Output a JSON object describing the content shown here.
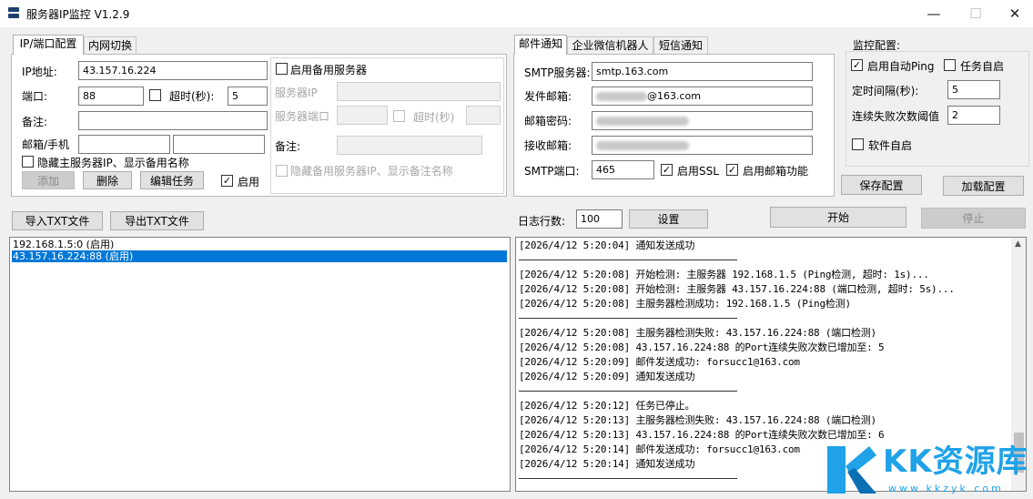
{
  "window": {
    "title": "服务器IP监控 V1.2.9",
    "min_symbol": "—",
    "max_symbol": "☐",
    "close_symbol": "✕"
  },
  "left_tabs": [
    "IP/端口配置",
    "内网切换"
  ],
  "main_server": {
    "ip_label": "IP地址:",
    "ip_value": "43.157.16.224",
    "port_label": "端口:",
    "port_value": "88",
    "timeout_label": "超时(秒):",
    "timeout_value": "5",
    "timeout_checked": false,
    "note_label": "备注:",
    "note_value": "",
    "contact_label": "邮箱/手机",
    "contact_value1": "",
    "contact_value2": "",
    "hide_label": "隐藏主服务器IP、显示备用名称",
    "hide_checked": false,
    "add_label": "添加",
    "delete_label": "删除",
    "edit_label": "编辑任务",
    "enable_label": "启用",
    "enable_checked": true
  },
  "backup_server": {
    "enable_label": "启用备用服务器",
    "enable_checked": false,
    "ip_label": "服务器IP",
    "port_label": "服务器端口",
    "timeout_label": "超时(秒)",
    "note_label": "备注:",
    "hide_label": "隐藏备用服务器IP、显示备注名称"
  },
  "notify_tabs": [
    "邮件通知",
    "企业微信机器人",
    "短信通知"
  ],
  "email": {
    "smtp_server_label": "SMTP服务器:",
    "smtp_server_value": "smtp.163.com",
    "sender_label": "发件邮箱:",
    "sender_value_visible": "@163.com",
    "password_label": "邮箱密码:",
    "receiver_label": "接收邮箱:",
    "smtp_port_label": "SMTP端口:",
    "smtp_port_value": "465",
    "ssl_label": "启用SSL",
    "ssl_checked": true,
    "email_enable_label": "启用邮箱功能",
    "email_enable_checked": true
  },
  "monitor": {
    "title": "监控配置:",
    "ping_label": "启用自动Ping",
    "ping_checked": true,
    "task_autostart_label": "任务自启",
    "task_autostart_checked": false,
    "interval_label": "定时间隔(秒):",
    "interval_value": "5",
    "fail_threshold_label": "连续失败次数阈值",
    "fail_threshold_value": "2",
    "software_autostart_label": "软件自启",
    "software_autostart_checked": false,
    "save_label": "保存配置",
    "load_label": "加载配置"
  },
  "file_buttons": {
    "import_label": "导入TXT文件",
    "export_label": "导出TXT文件"
  },
  "log_controls": {
    "lines_label": "日志行数:",
    "lines_value": "100",
    "set_label": "设置",
    "start_label": "开始",
    "stop_label": "停止"
  },
  "server_list": [
    {
      "text": "192.168.1.5:0 (启用)",
      "selected": false
    },
    {
      "text": "43.157.16.224:88 (启用)",
      "selected": true
    }
  ],
  "log_lines": [
    "[2026/4/12 5:20:04] 通知发送成功",
    "",
    "[2026/4/12 5:20:08] 开始检测: 主服务器 192.168.1.5 (Ping检测, 超时: 1s)...",
    "[2026/4/12 5:20:08] 开始检测: 主服务器 43.157.16.224:88 (端口检测, 超时: 5s)...",
    "[2026/4/12 5:20:08] 主服务器检测成功: 192.168.1.5 (Ping检测)",
    "",
    "[2026/4/12 5:20:08] 主服务器检测失败: 43.157.16.224:88 (端口检测)",
    "[2026/4/12 5:20:08] 43.157.16.224:88 的Port连续失败次数已增加至: 5",
    "[2026/4/12 5:20:09] 邮件发送成功: forsucc1@163.com",
    "[2026/4/12 5:20:09] 通知发送成功",
    "",
    "[2026/4/12 5:20:12] 任务已停止。",
    "[2026/4/12 5:20:13] 主服务器检测失败: 43.157.16.224:88 (端口检测)",
    "[2026/4/12 5:20:13] 43.157.16.224:88 的Port连续失败次数已增加至: 6",
    "[2026/4/12 5:20:14] 邮件发送成功: forsucc1@163.com",
    "[2026/4/12 5:20:14] 通知发送成功"
  ],
  "watermark": {
    "brand": "KK资源库",
    "url": "www.kkzyk.com",
    "color": "#1fa2e8"
  }
}
